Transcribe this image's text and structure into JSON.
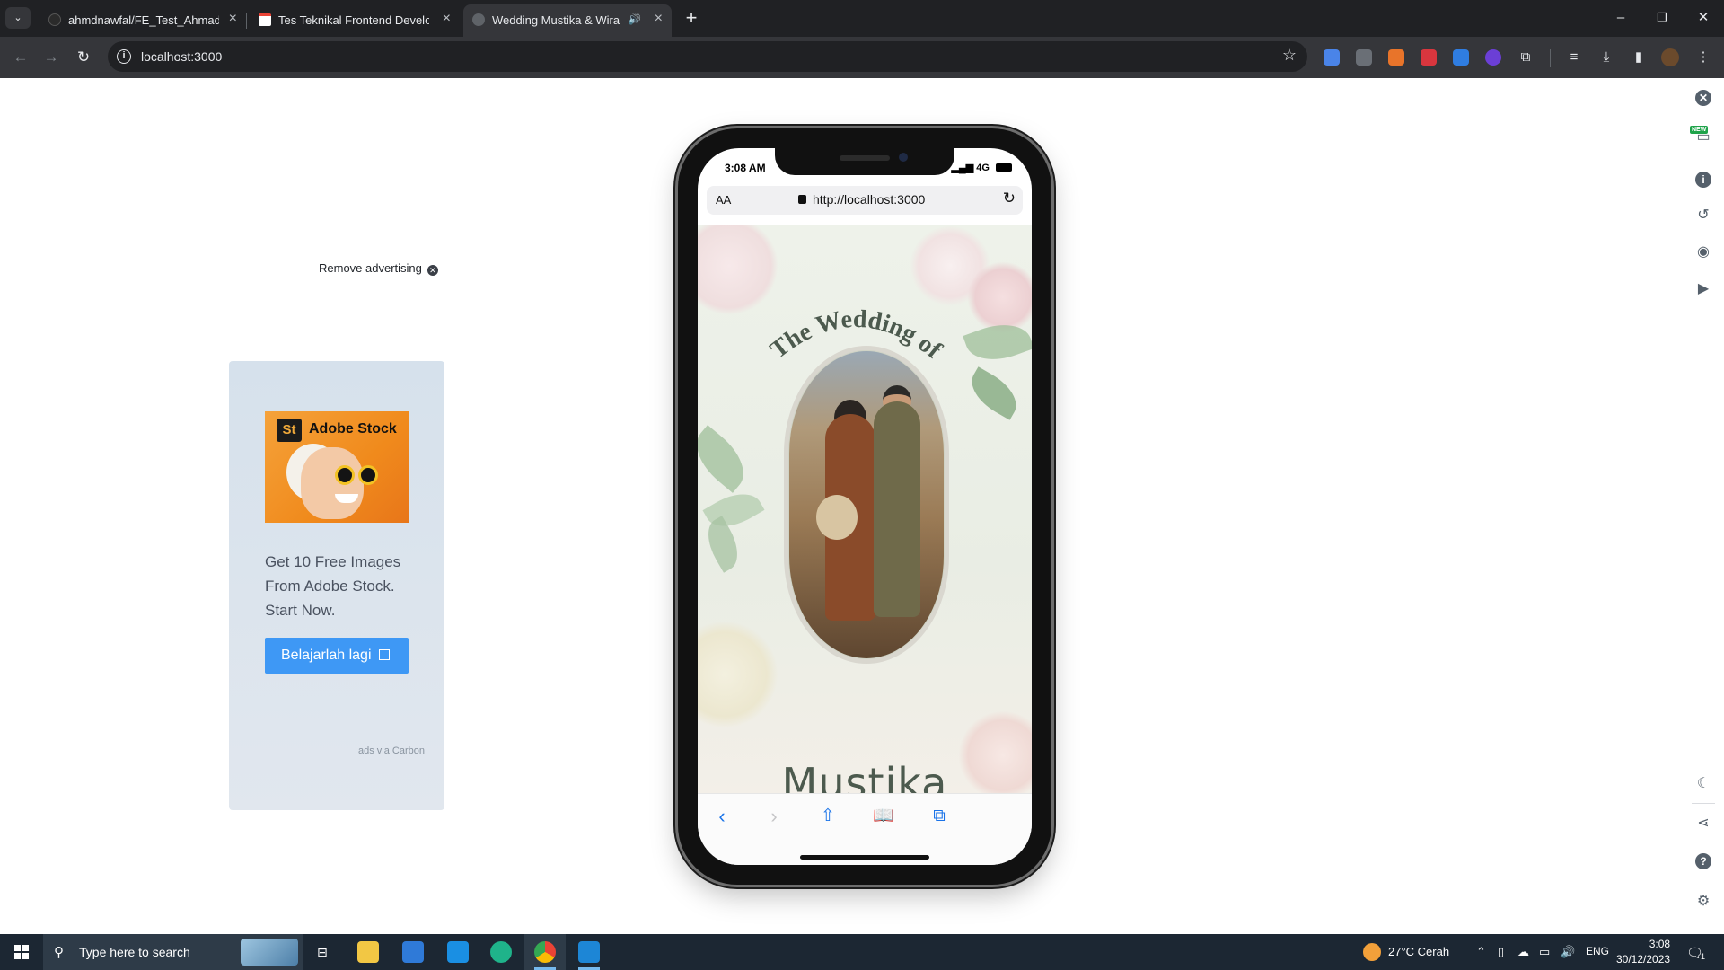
{
  "tabs": [
    {
      "title": "ahmdnawfal/FE_Test_Ahmad-Na",
      "close": "×"
    },
    {
      "title": "Tes Teknikal Frontend Develope",
      "close": "×"
    },
    {
      "title": "Wedding Mustika & Wira",
      "close": "×",
      "audio": "🔊"
    }
  ],
  "toolbar": {
    "url": "localhost:3000"
  },
  "ad": {
    "remove_label": "Remove advertising",
    "brand_badge": "St",
    "brand_name": "Adobe Stock",
    "body": "Get 10 Free Images From Adobe Stock. Start Now.",
    "cta": "Belajarlah lagi",
    "via": "ads via Carbon"
  },
  "phone": {
    "status_time": "3:08 AM",
    "network": "4G",
    "aa": "AA",
    "url": "http://localhost:3000",
    "heading": "The Wedding of",
    "name": "Mustika"
  },
  "taskbar": {
    "search_placeholder": "Type here to search",
    "weather": "27°C  Cerah",
    "lang": "ENG",
    "time": "3:08",
    "date": "30/12/2023",
    "notif_count": "1"
  },
  "colors": {
    "accent_blue": "#3e98f5",
    "chrome_dark": "#202124",
    "chrome_toolbar": "#35363a",
    "wedding_green": "#4c5a4e"
  }
}
